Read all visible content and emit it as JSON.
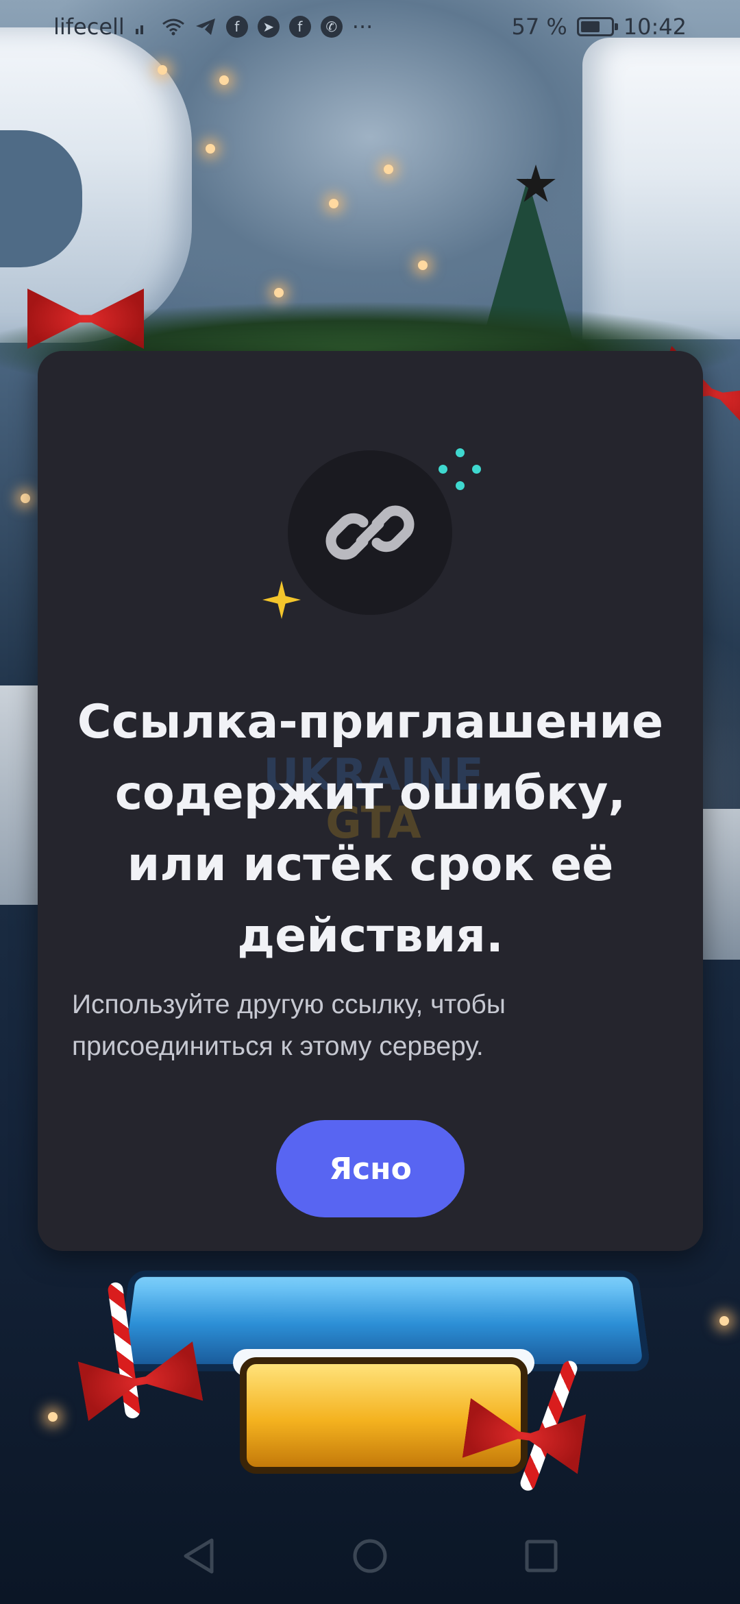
{
  "status_bar": {
    "carrier": "lifecell",
    "battery_percent": "57 %",
    "battery_level": 0.57,
    "time": "10:42",
    "notification_icons": [
      "wifi-icon",
      "telegram-icon",
      "facebook-icon",
      "messenger-icon",
      "facebook-icon",
      "viber-icon"
    ],
    "overflow": "···"
  },
  "dialog": {
    "icon": "link-icon",
    "title_lines": [
      "Ссылка-приглашение",
      "содержит ошибку,",
      "или истёк срок её",
      "действия."
    ],
    "subtitle_lines": [
      "Используйте другую ссылку, чтобы",
      "присоединиться к этому серверу."
    ],
    "button_label": "Ясно",
    "accent_color": "#5865f2",
    "card_color": "#25252d"
  },
  "watermark": {
    "line1": "UKRAINE",
    "line2": "GTA"
  },
  "navigation": {
    "back": "back-icon",
    "home": "home-icon",
    "recents": "recents-icon"
  }
}
